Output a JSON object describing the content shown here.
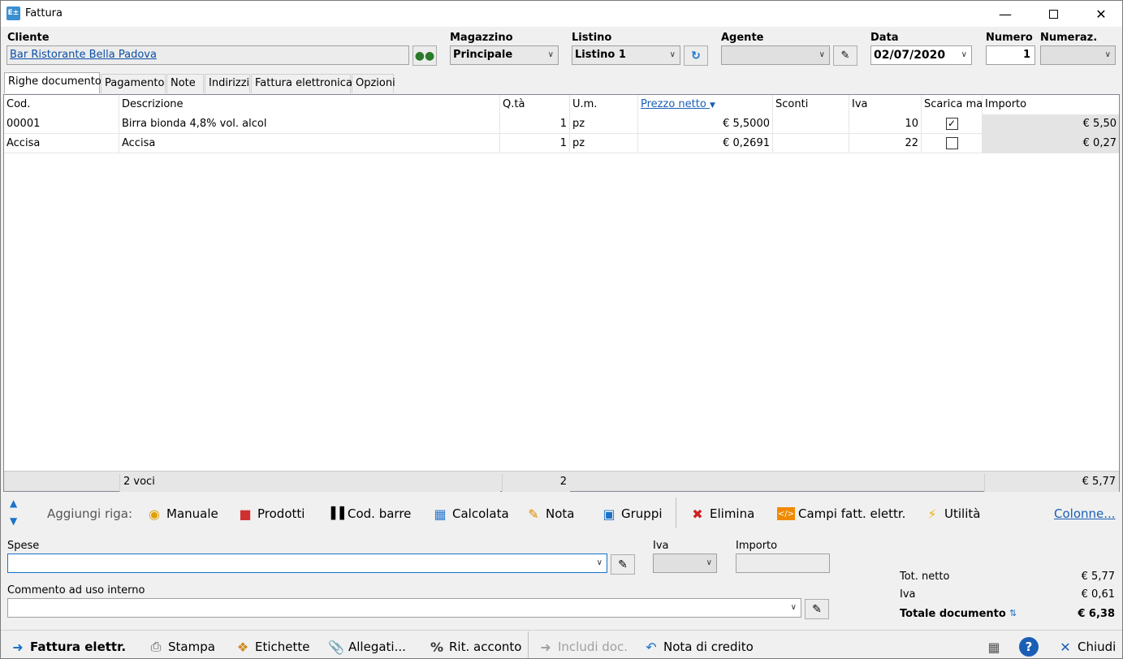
{
  "window": {
    "title": "Fattura",
    "icon": "E±"
  },
  "header": {
    "cliente": {
      "label": "Cliente",
      "value": "Bar Ristorante Bella Padova"
    },
    "magazzino": {
      "label": "Magazzino",
      "value": "Principale"
    },
    "listino": {
      "label": "Listino",
      "value": "Listino 1"
    },
    "agente": {
      "label": "Agente",
      "value": ""
    },
    "data": {
      "label": "Data",
      "value": "02/07/2020"
    },
    "numero": {
      "label": "Numero",
      "value": "1"
    },
    "numeraz": {
      "label": "Numeraz.",
      "value": ""
    }
  },
  "tabs": [
    "Righe documento",
    "Pagamento",
    "Note",
    "Indirizzi",
    "Fattura elettronica",
    "Opzioni"
  ],
  "grid": {
    "columns": [
      "Cod.",
      "Descrizione",
      "Q.tà",
      "U.m.",
      "Prezzo netto",
      "Sconti",
      "Iva",
      "Scarica ma",
      "Importo"
    ],
    "rows": [
      {
        "cod": "00001",
        "desc": "Birra bionda 4,8% vol. alcol",
        "qta": "1",
        "um": "pz",
        "prezzo": "€ 5,5000",
        "sconti": "",
        "iva": "10",
        "scarica": true,
        "importo": "€ 5,50"
      },
      {
        "cod": "Accisa",
        "desc": "Accisa",
        "qta": "1",
        "um": "pz",
        "prezzo": "€ 0,2691",
        "sconti": "",
        "iva": "22",
        "scarica": false,
        "importo": "€ 0,27"
      }
    ],
    "footer": {
      "voci": "2 voci",
      "qta": "2",
      "importo": "€ 5,77"
    }
  },
  "toolbar": {
    "label": "Aggiungi riga:",
    "manuale": "Manuale",
    "prodotti": "Prodotti",
    "codbarre": "Cod. barre",
    "calcolata": "Calcolata",
    "nota": "Nota",
    "gruppi": "Gruppi",
    "elimina": "Elimina",
    "campi": "Campi fatt. elettr.",
    "utilita": "Utilità",
    "colonne": "Colonne..."
  },
  "spese": {
    "label": "Spese",
    "value": "",
    "iva_label": "Iva",
    "importo_label": "Importo"
  },
  "commento": {
    "label": "Commento ad uso interno",
    "value": ""
  },
  "totals": {
    "netto_label": "Tot. netto",
    "netto": "€ 5,77",
    "iva_label": "Iva",
    "iva": "€ 0,61",
    "totale_label": "Totale documento",
    "totale": "€ 6,38"
  },
  "bottom": {
    "fattura": "Fattura elettr.",
    "stampa": "Stampa",
    "etichette": "Etichette",
    "allegati": "Allegati...",
    "rit": "Rit. acconto",
    "includi": "Includi doc.",
    "nota_credito": "Nota di credito",
    "chiudi": "Chiudi"
  }
}
